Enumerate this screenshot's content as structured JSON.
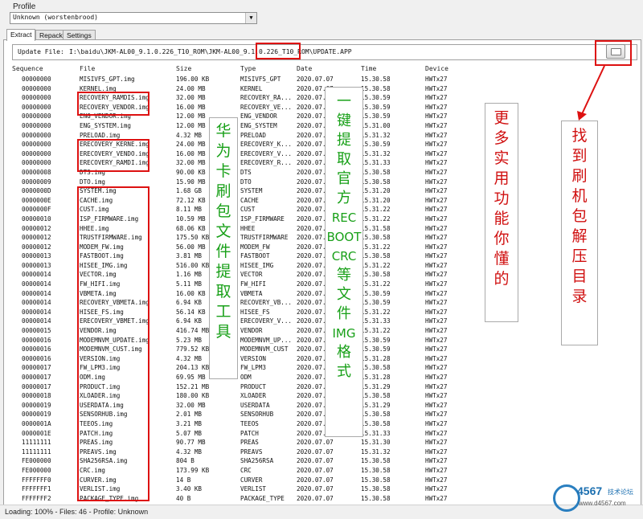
{
  "profile": {
    "label": "Profile",
    "selected": "Unknown (worstenbrood)"
  },
  "tabs": [
    "Extract",
    "Repack",
    "Settings"
  ],
  "update_file": {
    "label": "Update File:",
    "path": "I:\\baidu\\JKM-AL00_9.1.0.226_T10_ROM\\JKM-AL00_9.1.0.226_T10_ROM\\UPDATE.APP"
  },
  "columns": [
    "Sequence",
    "File",
    "Size",
    "Type",
    "Date",
    "Time",
    "Device"
  ],
  "rows": [
    [
      "00000000",
      "MISIVFS_GPT.img",
      "196.00 KB",
      "MISIVFS_GPT",
      "2020.07.07",
      "15.30.58",
      "HWTx27"
    ],
    [
      "00000000",
      "KERNEL.img",
      "24.00 MB",
      "KERNEL",
      "2020.07.07",
      "15.30.58",
      "HWTx27"
    ],
    [
      "00000000",
      "RECOVERY_RAMDIS.img",
      "32.00 MB",
      "RECOVERY_RA...",
      "2020.07.07",
      "15.30.59",
      "HWTx27"
    ],
    [
      "00000000",
      "RECOVERY_VENDOR.img",
      "16.00 MB",
      "RECOVERY_VE...",
      "2020.07.07",
      "15.30.59",
      "HWTx27"
    ],
    [
      "00000000",
      "ENG_VENDOR.img",
      "12.00 MB",
      "ENG_VENDOR",
      "2020.07.07",
      "15.30.59",
      "HWTx27"
    ],
    [
      "00000000",
      "ENG_SYSTEM.img",
      "12.00 MB",
      "ENG_SYSTEM",
      "2020.07.07",
      "15.31.00",
      "HWTx27"
    ],
    [
      "00000000",
      "PRELOAD.img",
      "4.32 MB",
      "PRELOAD",
      "2020.07.07",
      "15.31.32",
      "HWTx27"
    ],
    [
      "00000000",
      "ERECOVERY_KERNE.img",
      "24.00 MB",
      "ERECOVERY_K...",
      "2020.07.07",
      "15.30.59",
      "HWTx27"
    ],
    [
      "00000000",
      "ERECOVERY_VENDO.img",
      "16.00 MB",
      "ERECOVERY_V...",
      "2020.07.07",
      "15.31.32",
      "HWTx27"
    ],
    [
      "00000000",
      "ERECOVERY_RAMDI.img",
      "32.00 MB",
      "ERECOVERY_R...",
      "2020.07.07",
      "15.31.33",
      "HWTx27"
    ],
    [
      "00000008",
      "DTS.img",
      "90.00 KB",
      "DTS",
      "2020.07.07",
      "15.30.58",
      "HWTx27"
    ],
    [
      "00000009",
      "DTO.img",
      "15.90 MB",
      "DTO",
      "2020.07.07",
      "15.30.58",
      "HWTx27"
    ],
    [
      "0000000D",
      "SYSTEM.img",
      "1.68 GB",
      "SYSTEM",
      "2020.07.07",
      "15.31.20",
      "HWTx27"
    ],
    [
      "0000000E",
      "CACHE.img",
      "72.12 KB",
      "CACHE",
      "2020.07.07",
      "15.31.20",
      "HWTx27"
    ],
    [
      "0000000F",
      "CUST.img",
      "8.11 MB",
      "CUST",
      "2020.07.07",
      "15.31.22",
      "HWTx27"
    ],
    [
      "00000010",
      "ISP_FIRMWARE.img",
      "10.59 MB",
      "ISP_FIRMWARE",
      "2020.07.07",
      "15.31.22",
      "HWTx27"
    ],
    [
      "00000012",
      "HHEE.img",
      "68.06 KB",
      "HHEE",
      "2020.07.07",
      "15.31.58",
      "HWTx27"
    ],
    [
      "00000012",
      "TRUSTFIRMWARE.img",
      "175.50 KB",
      "TRUSTFIRMWARE",
      "2020.07.07",
      "15.30.58",
      "HWTx27"
    ],
    [
      "00000012",
      "MODEM_FW.img",
      "56.00 MB",
      "MODEM_FW",
      "2020.07.07",
      "15.31.22",
      "HWTx27"
    ],
    [
      "00000013",
      "FASTBOOT.img",
      "3.81 MB",
      "FASTBOOT",
      "2020.07.07",
      "15.30.58",
      "HWTx27"
    ],
    [
      "00000013",
      "HISEE_IMG.img",
      "516.00 KB",
      "HISEE_IMG",
      "2020.07.07",
      "15.31.22",
      "HWTx27"
    ],
    [
      "00000014",
      "VECTOR.img",
      "1.16 MB",
      "VECTOR",
      "2020.07.07",
      "15.30.58",
      "HWTx27"
    ],
    [
      "00000014",
      "FW_HIFI.img",
      "5.11 MB",
      "FW_HIFI",
      "2020.07.07",
      "15.31.22",
      "HWTx27"
    ],
    [
      "00000014",
      "VBMETA.img",
      "16.00 KB",
      "VBMETA",
      "2020.07.07",
      "15.30.59",
      "HWTx27"
    ],
    [
      "00000014",
      "RECOVERY_VBMETA.img",
      "6.94 KB",
      "RECOVERY_VB...",
      "2020.07.07",
      "15.30.59",
      "HWTx27"
    ],
    [
      "00000014",
      "HISEE_FS.img",
      "56.14 KB",
      "HISEE_FS",
      "2020.07.07",
      "15.31.22",
      "HWTx27"
    ],
    [
      "00000014",
      "ERECOVERY_VBMET.img",
      "6.94 KB",
      "ERECOVERY_V...",
      "2020.07.07",
      "15.31.33",
      "HWTx27"
    ],
    [
      "00000015",
      "VENDOR.img",
      "416.74 MB",
      "VENDOR",
      "2020.07.07",
      "15.31.22",
      "HWTx27"
    ],
    [
      "00000016",
      "MODEMNVM_UPDATE.img",
      "5.23 MB",
      "MODEMNVM_UP...",
      "2020.07.07",
      "15.30.59",
      "HWTx27"
    ],
    [
      "00000016",
      "MODEMNVM_CUST.img",
      "779.52 KB",
      "MODEMNVM_CUST",
      "2020.07.07",
      "15.30.59",
      "HWTx27"
    ],
    [
      "00000016",
      "VERSION.img",
      "4.32 MB",
      "VERSION",
      "2020.07.07",
      "15.31.28",
      "HWTx27"
    ],
    [
      "00000017",
      "FW_LPM3.img",
      "204.13 KB",
      "FW_LPM3",
      "2020.07.07",
      "15.30.58",
      "HWTx27"
    ],
    [
      "00000017",
      "ODM.img",
      "69.95 MB",
      "ODM",
      "2020.07.07",
      "15.31.28",
      "HWTx27"
    ],
    [
      "00000017",
      "PRODUCT.img",
      "152.21 MB",
      "PRODUCT",
      "2020.07.07",
      "15.31.29",
      "HWTx27"
    ],
    [
      "00000018",
      "XLOADER.img",
      "180.00 KB",
      "XLOADER",
      "2020.07.07",
      "15.30.58",
      "HWTx27"
    ],
    [
      "00000019",
      "USERDATA.img",
      "32.00 MB",
      "USERDATA",
      "2020.07.07",
      "15.31.29",
      "HWTx27"
    ],
    [
      "00000019",
      "SENSORHUB.img",
      "2.01 MB",
      "SENSORHUB",
      "2020.07.07",
      "15.30.58",
      "HWTx27"
    ],
    [
      "0000001A",
      "TEEOS.img",
      "3.21 MB",
      "TEEOS",
      "2020.07.07",
      "15.30.58",
      "HWTx27"
    ],
    [
      "0000001E",
      "PATCH.img",
      "5.07 MB",
      "PATCH",
      "2020.07.07",
      "15.31.33",
      "HWTx27"
    ],
    [
      "11111111",
      "PREAS.img",
      "90.77 MB",
      "PREAS",
      "2020.07.07",
      "15.31.30",
      "HWTx27"
    ],
    [
      "11111111",
      "PREAVS.img",
      "4.32 MB",
      "PREAVS",
      "2020.07.07",
      "15.31.32",
      "HWTx27"
    ],
    [
      "FE000000",
      "SHA256RSA.img",
      "804 B",
      "SHA256RSA",
      "2020.07.07",
      "15.30.58",
      "HWTx27"
    ],
    [
      "FE000000",
      "CRC.img",
      "173.99 KB",
      "CRC",
      "2020.07.07",
      "15.30.58",
      "HWTx27"
    ],
    [
      "FFFFFFF0",
      "CURVER.img",
      "14 B",
      "CURVER",
      "2020.07.07",
      "15.30.58",
      "HWTx27"
    ],
    [
      "FFFFFFF1",
      "VERLIST.img",
      "3.40 KB",
      "VERLIST",
      "2020.07.07",
      "15.30.58",
      "HWTx27"
    ],
    [
      "FFFFFFF2",
      "PACKAGE_TYPE.img",
      "40 B",
      "PACKAGE_TYPE",
      "2020.07.07",
      "15.30.58",
      "HWTx27"
    ]
  ],
  "status": "Loading: 100% - Files: 46 - Profile: Unknown",
  "annotations": {
    "huawei_tool": "华为卡刷包文件提取工具",
    "one_click": "一键提取官方RECBOOTCRC等文件IMG格式",
    "more_features": "更多实用功能你懂的",
    "find_dir": "找到刷机包解压目录"
  },
  "watermark": {
    "num": "4567",
    "cn": "技术论坛",
    "url": "www.d4567.com"
  }
}
